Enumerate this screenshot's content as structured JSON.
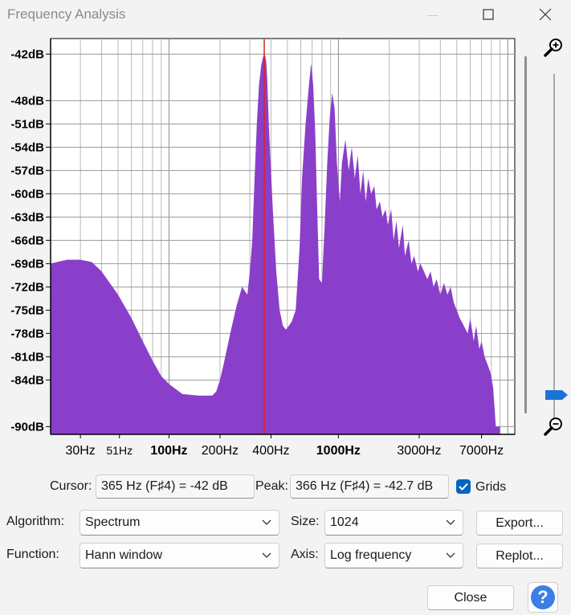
{
  "window": {
    "title": "Frequency Analysis",
    "minimize_glyph": "—",
    "maximize_icon": "maximize-icon",
    "close_icon": "close-icon"
  },
  "chart_data": {
    "type": "area",
    "x_scale": "log",
    "y_unit": "dB",
    "y_ticks": [
      "-42dB",
      "-48dB",
      "-51dB",
      "-54dB",
      "-57dB",
      "-60dB",
      "-63dB",
      "-66dB",
      "-69dB",
      "-72dB",
      "-75dB",
      "-78dB",
      "-81dB",
      "-84dB",
      "-90dB"
    ],
    "y_tick_values": [
      -42,
      -48,
      -51,
      -54,
      -57,
      -60,
      -63,
      -66,
      -69,
      -72,
      -75,
      -78,
      -81,
      -84,
      -90
    ],
    "x_ticks": [
      {
        "label": "30Hz",
        "value": 30,
        "bold": false
      },
      {
        "label": "51Hz",
        "value": 51,
        "bold": false
      },
      {
        "label": "100Hz",
        "value": 100,
        "bold": true
      },
      {
        "label": "200Hz",
        "value": 200,
        "bold": false
      },
      {
        "label": "400Hz",
        "value": 400,
        "bold": false
      },
      {
        "label": "1000Hz",
        "value": 1000,
        "bold": true
      },
      {
        "label": "3000Hz",
        "value": 3000,
        "bold": false
      },
      {
        "label": "7000Hz",
        "value": 7000,
        "bold": false
      }
    ],
    "xlim": [
      20,
      11000
    ],
    "ylim": [
      -91,
      -40
    ],
    "grid": true,
    "fill_color": "#8a3fca",
    "cursor_color": "#e02020",
    "cursor_hz": 365,
    "series": [
      {
        "x": [
          20,
          25,
          30,
          35,
          40,
          50,
          60,
          70,
          80,
          90,
          100,
          120,
          150,
          170,
          180,
          190,
          200,
          210,
          230,
          250,
          270,
          290,
          300,
          310,
          320,
          330,
          340,
          350,
          360,
          365,
          370,
          375,
          380,
          390,
          410,
          430,
          450,
          470,
          490,
          510,
          530,
          560,
          590,
          610,
          640,
          670,
          690,
          710,
          730,
          750,
          770,
          800,
          830,
          860,
          890,
          920,
          950,
          980,
          1020,
          1050,
          1100,
          1150,
          1200,
          1250,
          1300,
          1350,
          1400,
          1450,
          1500,
          1560,
          1630,
          1680,
          1760,
          1820,
          1900,
          1960,
          2050,
          2120,
          2200,
          2280,
          2400,
          2470,
          2600,
          2700,
          2800,
          2950,
          3050,
          3200,
          3350,
          3500,
          3650,
          3800,
          4000,
          4200,
          4400,
          4600,
          4800,
          5000,
          5200,
          5500,
          5800,
          6000,
          6300,
          6500,
          6800,
          7000,
          7300,
          7600,
          7900,
          8200,
          8500,
          8800,
          9000
        ],
        "y": [
          -69,
          -68.5,
          -68.5,
          -68.8,
          -70,
          -73,
          -76,
          -79,
          -81.5,
          -83.5,
          -84.5,
          -85.8,
          -86,
          -86,
          -86,
          -85.5,
          -84,
          -82,
          -78,
          -74.5,
          -72,
          -73,
          -70,
          -66,
          -58,
          -51,
          -46,
          -43.5,
          -42.3,
          -42,
          -42.3,
          -43,
          -45,
          -52,
          -62,
          -70,
          -75,
          -77,
          -77.5,
          -77,
          -76.5,
          -75,
          -67,
          -58,
          -51,
          -46,
          -43.2,
          -46,
          -52,
          -62,
          -71,
          -71.5,
          -64,
          -56,
          -50,
          -47,
          -49,
          -56,
          -61,
          -56,
          -53,
          -57,
          -54,
          -58,
          -55,
          -60,
          -57,
          -61,
          -58,
          -60,
          -59,
          -62,
          -61,
          -63,
          -62,
          -64,
          -62,
          -66,
          -63.5,
          -67,
          -64,
          -68,
          -66,
          -69,
          -68,
          -70,
          -69,
          -70,
          -71,
          -70,
          -72,
          -71,
          -73,
          -71.5,
          -73,
          -72,
          -74,
          -75,
          -76,
          -77,
          -78,
          -76,
          -79,
          -77,
          -80,
          -79,
          -81,
          -82,
          -83,
          -85,
          -90,
          -90,
          -90
        ]
      }
    ]
  },
  "cursor": {
    "label": "Cursor:",
    "value": "365 Hz (F♯4) = -42 dB"
  },
  "peak": {
    "label": "Peak:",
    "value": "366 Hz (F♯4) = -42.7 dB"
  },
  "grids": {
    "label": "Grids",
    "checked": true
  },
  "algorithm": {
    "label": "Algorithm:",
    "value": "Spectrum"
  },
  "function": {
    "label": "Function:",
    "value": "Hann window"
  },
  "size": {
    "label": "Size:",
    "value": "1024"
  },
  "axis": {
    "label": "Axis:",
    "value": "Log frequency"
  },
  "buttons": {
    "export": "Export...",
    "replot": "Replot...",
    "close": "Close",
    "help": "?"
  },
  "zoom": {
    "in_icon": "zoom-in-icon",
    "out_icon": "zoom-out-icon",
    "level": 0.93
  }
}
